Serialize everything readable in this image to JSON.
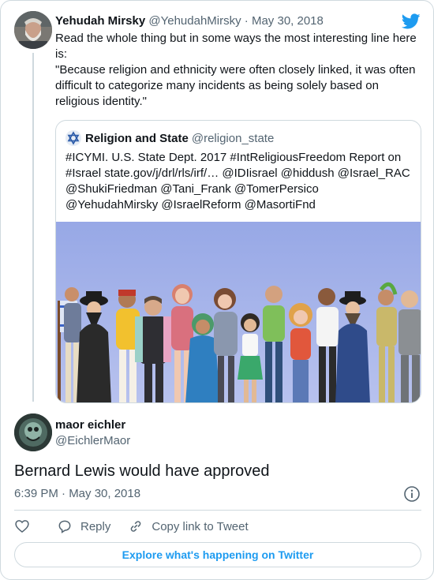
{
  "parent_tweet": {
    "author_name": "Yehudah Mirsky",
    "author_handle": "@YehudahMirsky",
    "separator": "·",
    "date": "May 30, 2018",
    "text_line1": "Read the whole thing but in some ways the most interesting line here is:",
    "text_line2": "\"Because religion and ethnicity were often closely linked, it was often difficult to categorize many incidents as being solely based on religious identity.\""
  },
  "quoted_tweet": {
    "author_name": "Religion and State",
    "author_handle": "@religion_state",
    "text": "#ICYMI. U.S. State Dept. 2017 #IntReligiousFreedom Report on #Israel state.gov/j/drl/rls/irf/… @IDIisrael @hiddush @Israel_RAC @ShukiFriedman @Tani_Frank @TomerPersico @YehudahMirsky @IsraelReform @MasortiFnd"
  },
  "reply_tweet": {
    "author_name": "maor eichler",
    "author_handle": "@EichlerMaor",
    "text": "Bernard Lewis would have approved",
    "timestamp": "6:39 PM · May 30, 2018"
  },
  "actions": {
    "reply_label": "Reply",
    "copy_link_label": "Copy link to Tweet"
  },
  "explore_label": "Explore what's happening on Twitter",
  "icons": {
    "brand": "twitter-bird-icon",
    "info": "info-icon",
    "like": "heart-icon",
    "reply": "speech-bubble-icon",
    "link": "link-icon"
  },
  "colors": {
    "accent": "#1d9bf0",
    "text_primary": "#0f1419",
    "text_secondary": "#536471",
    "border": "#cfd9de"
  }
}
